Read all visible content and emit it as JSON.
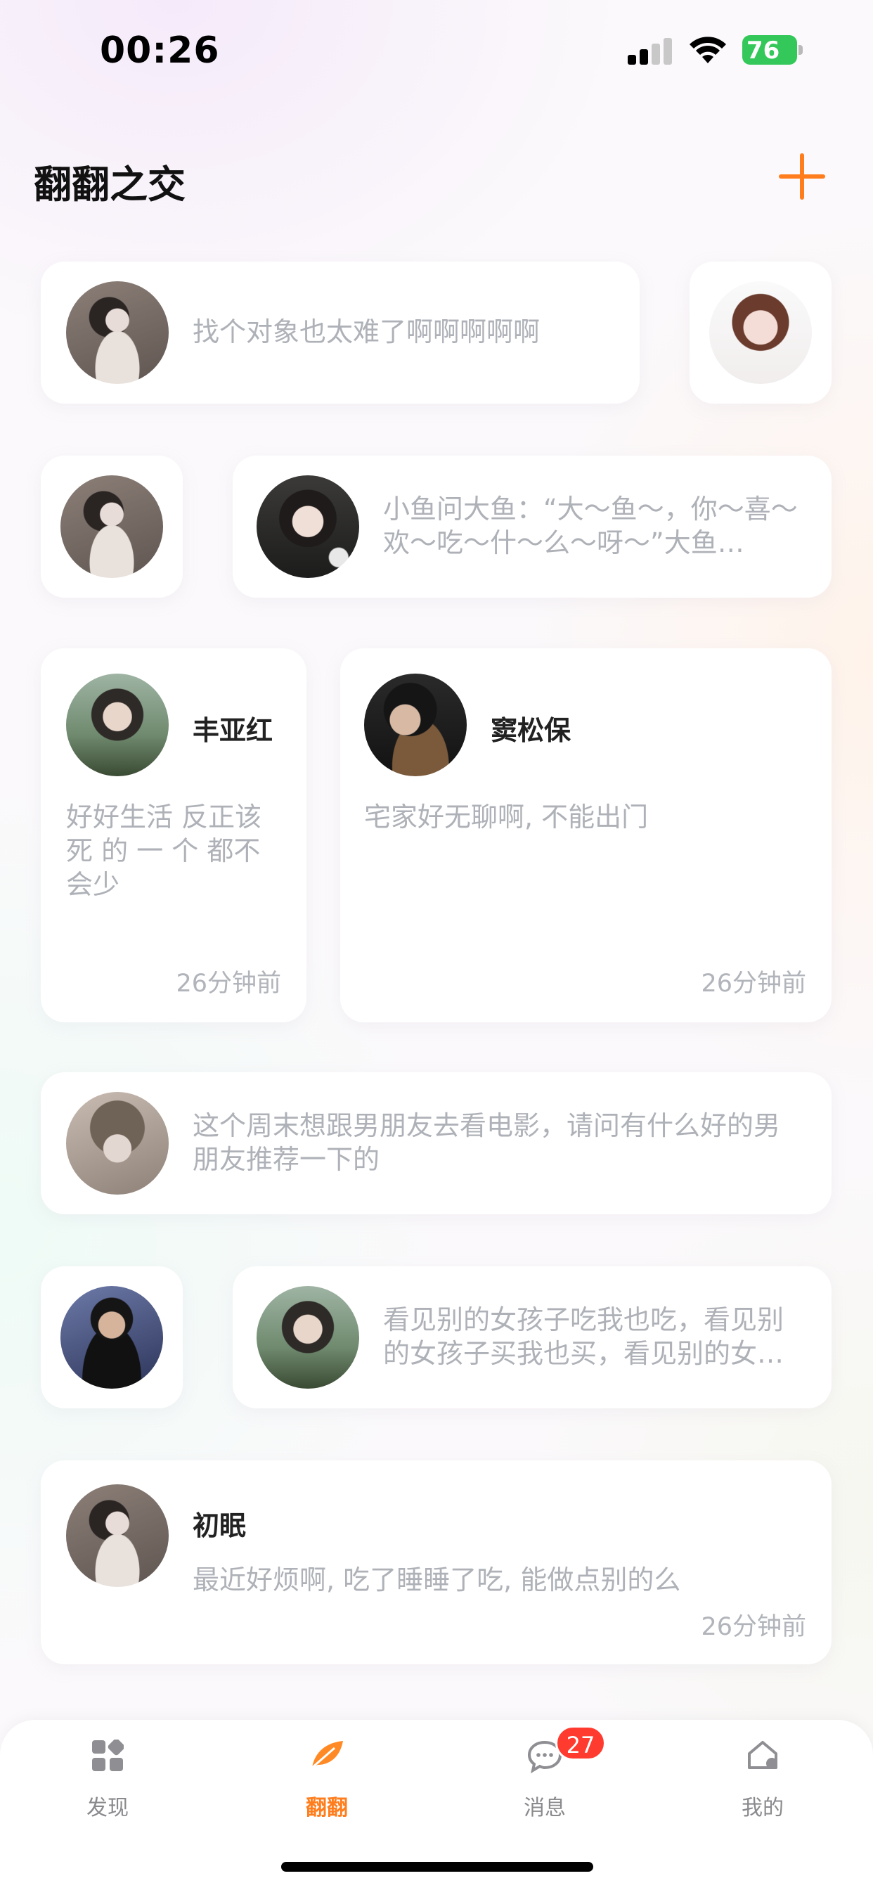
{
  "status_bar": {
    "time": "00:26",
    "battery": "76"
  },
  "header": {
    "title": "翻翻之交"
  },
  "feed": [
    {
      "text": "找个对象也太难了啊啊啊啊啊"
    },
    {
      "text": "小鱼问大鱼：“大～鱼～，你～喜～欢～吃～什～么～呀～”大鱼说：“小～鱼～”"
    },
    {
      "name": "丰亚红",
      "text": "好好生活 反正该死 的 一 个 都不会少",
      "time": "26分钟前"
    },
    {
      "name": "窦松保",
      "text": "宅家好无聊啊, 不能出门",
      "time": "26分钟前"
    },
    {
      "text": "这个周末想跟男朋友去看电影，请问有什么好的男朋友推荐一下的"
    },
    {
      "text": "看见别的女孩子吃我也吃，看见别的女孩子买我也买，看见别的女孩子"
    },
    {
      "name": "初眠",
      "text": "最近好烦啊, 吃了睡睡了吃, 能做点别的么",
      "time": "26分钟前"
    }
  ],
  "tabbar": {
    "tabs": [
      {
        "label": "发现",
        "icon": "discover-icon"
      },
      {
        "label": "翻翻",
        "icon": "leaf-icon",
        "active": true
      },
      {
        "label": "消息",
        "icon": "message-icon",
        "badge": "27"
      },
      {
        "label": "我的",
        "icon": "home-profile-icon"
      }
    ]
  },
  "colors": {
    "accent": "#ff7d1c",
    "badge": "#ff3b30",
    "battery": "#34c759"
  }
}
